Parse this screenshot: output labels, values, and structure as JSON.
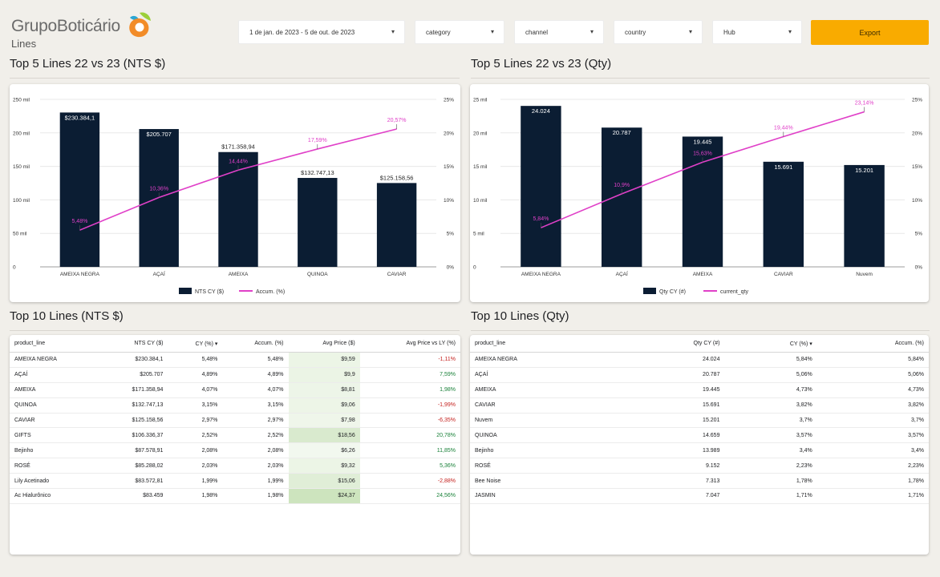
{
  "brand": {
    "name": "GrupoBoticário",
    "sub": "Lines"
  },
  "filters": {
    "date": "1 de jan. de 2023 - 5 de out. de 2023",
    "category": "category",
    "channel": "channel",
    "country": "country",
    "hub": "Hub",
    "export": "Export"
  },
  "sections": {
    "top5_nts": "Top 5 Lines 22 vs 23 (NTS $)",
    "top5_qty": "Top 5 Lines 22 vs 23 (Qty)",
    "top10_nts": "Top 10 Lines (NTS $)",
    "top10_qty": "Top 10 Lines (Qty)"
  },
  "colors": {
    "bar": "#0b1d33",
    "line": "#e040c8",
    "accent": "#f9ab00",
    "heat": "#d9ead3"
  },
  "chart_data": [
    {
      "type": "bar",
      "title": "Top 5 Lines 22 vs 23 (NTS $)",
      "categories": [
        "AMEIXA NEGRA",
        "AÇAÍ",
        "AMEIXA",
        "QUINOA",
        "CAVIAR"
      ],
      "series": [
        {
          "name": "NTS CY ($)",
          "type": "bar",
          "values": [
            230384.1,
            205707,
            171358.94,
            132747.13,
            125158.56
          ],
          "labels": [
            "$230.384,1",
            "$205.707",
            "$171.358,94",
            "$132.747,13",
            "$125.158,56"
          ]
        },
        {
          "name": "Accum. (%)",
          "type": "line",
          "axis": "right",
          "values": [
            5.48,
            10.36,
            14.44,
            17.59,
            20.57
          ],
          "labels": [
            "5,48%",
            "10,36%",
            "14,44%",
            "17,59%",
            "20,57%"
          ]
        }
      ],
      "ylim": [
        0,
        250000
      ],
      "y2lim": [
        0,
        25
      ],
      "yticks": [
        "0",
        "50 mil",
        "100 mil",
        "150 mil",
        "200 mil",
        "250 mil"
      ],
      "y2ticks": [
        "0%",
        "5%",
        "10%",
        "15%",
        "20%",
        "25%"
      ],
      "legend_position": "bottom",
      "grid": true
    },
    {
      "type": "bar",
      "title": "Top 5 Lines 22 vs 23 (Qty)",
      "categories": [
        "AMEIXA NEGRA",
        "AÇAÍ",
        "AMEIXA",
        "CAVIAR",
        "Nuvem"
      ],
      "series": [
        {
          "name": "Qty CY (#)",
          "type": "bar",
          "values": [
            24024,
            20787,
            19445,
            15691,
            15201
          ],
          "labels": [
            "24.024",
            "20.787",
            "19.445",
            "15.691",
            "15.201"
          ]
        },
        {
          "name": "current_qty",
          "type": "line",
          "axis": "right",
          "values": [
            5.84,
            10.9,
            15.63,
            19.44,
            23.14
          ],
          "labels": [
            "5,84%",
            "10,9%",
            "15,63%",
            "19,44%",
            "23,14%"
          ]
        }
      ],
      "ylim": [
        0,
        25000
      ],
      "y2lim": [
        0,
        25
      ],
      "yticks": [
        "0",
        "5 mil",
        "10 mil",
        "15 mil",
        "20 mil",
        "25 mil"
      ],
      "y2ticks": [
        "0%",
        "5%",
        "10%",
        "15%",
        "20%",
        "25%"
      ],
      "legend_position": "bottom",
      "grid": true
    },
    {
      "type": "table",
      "title": "Top 10 Lines (NTS $)",
      "columns": [
        "product_line",
        "NTS CY ($)",
        "CY (%) ▾",
        "Accum. (%)",
        "Avg Price ($)",
        "Avg Price vs LY (%)"
      ],
      "rows": [
        [
          "AMEIXA NEGRA",
          "$230.384,1",
          "5,48%",
          "5,48%",
          "$9,59",
          "-1,11%"
        ],
        [
          "AÇAÍ",
          "$205.707",
          "4,89%",
          "4,89%",
          "$9,9",
          "7,59%"
        ],
        [
          "AMEIXA",
          "$171.358,94",
          "4,07%",
          "4,07%",
          "$8,81",
          "1,98%"
        ],
        [
          "QUINOA",
          "$132.747,13",
          "3,15%",
          "3,15%",
          "$9,06",
          "-1,99%"
        ],
        [
          "CAVIAR",
          "$125.158,56",
          "2,97%",
          "2,97%",
          "$7,98",
          "-6,35%"
        ],
        [
          "GIFTS",
          "$106.336,37",
          "2,52%",
          "2,52%",
          "$18,56",
          "20,78%"
        ],
        [
          "Bejinho",
          "$87.578,91",
          "2,08%",
          "2,08%",
          "$6,26",
          "11,85%"
        ],
        [
          "ROSÉ",
          "$85.288,02",
          "2,03%",
          "2,03%",
          "$9,32",
          "5,36%"
        ],
        [
          "Lily Acetinado",
          "$83.572,81",
          "1,99%",
          "1,99%",
          "$15,06",
          "-2,88%"
        ],
        [
          "Ac Hialurônico",
          "$83.459",
          "1,98%",
          "1,98%",
          "$24,37",
          "24,56%"
        ]
      ],
      "avg_price_values": [
        9.59,
        9.9,
        8.81,
        9.06,
        7.98,
        18.56,
        6.26,
        9.32,
        15.06,
        24.37
      ]
    },
    {
      "type": "table",
      "title": "Top 10 Lines (Qty)",
      "columns": [
        "product_line",
        "Qty CY (#)",
        "CY (%) ▾",
        "Accum. (%)"
      ],
      "rows": [
        [
          "AMEIXA NEGRA",
          "24.024",
          "5,84%",
          "5,84%"
        ],
        [
          "AÇAÍ",
          "20.787",
          "5,06%",
          "5,06%"
        ],
        [
          "AMEIXA",
          "19.445",
          "4,73%",
          "4,73%"
        ],
        [
          "CAVIAR",
          "15.691",
          "3,82%",
          "3,82%"
        ],
        [
          "Nuvem",
          "15.201",
          "3,7%",
          "3,7%"
        ],
        [
          "QUINOA",
          "14.659",
          "3,57%",
          "3,57%"
        ],
        [
          "Bejinho",
          "13.989",
          "3,4%",
          "3,4%"
        ],
        [
          "ROSÉ",
          "9.152",
          "2,23%",
          "2,23%"
        ],
        [
          "Bee Noise",
          "7.313",
          "1,78%",
          "1,78%"
        ],
        [
          "JASMIN",
          "7.047",
          "1,71%",
          "1,71%"
        ]
      ]
    }
  ]
}
